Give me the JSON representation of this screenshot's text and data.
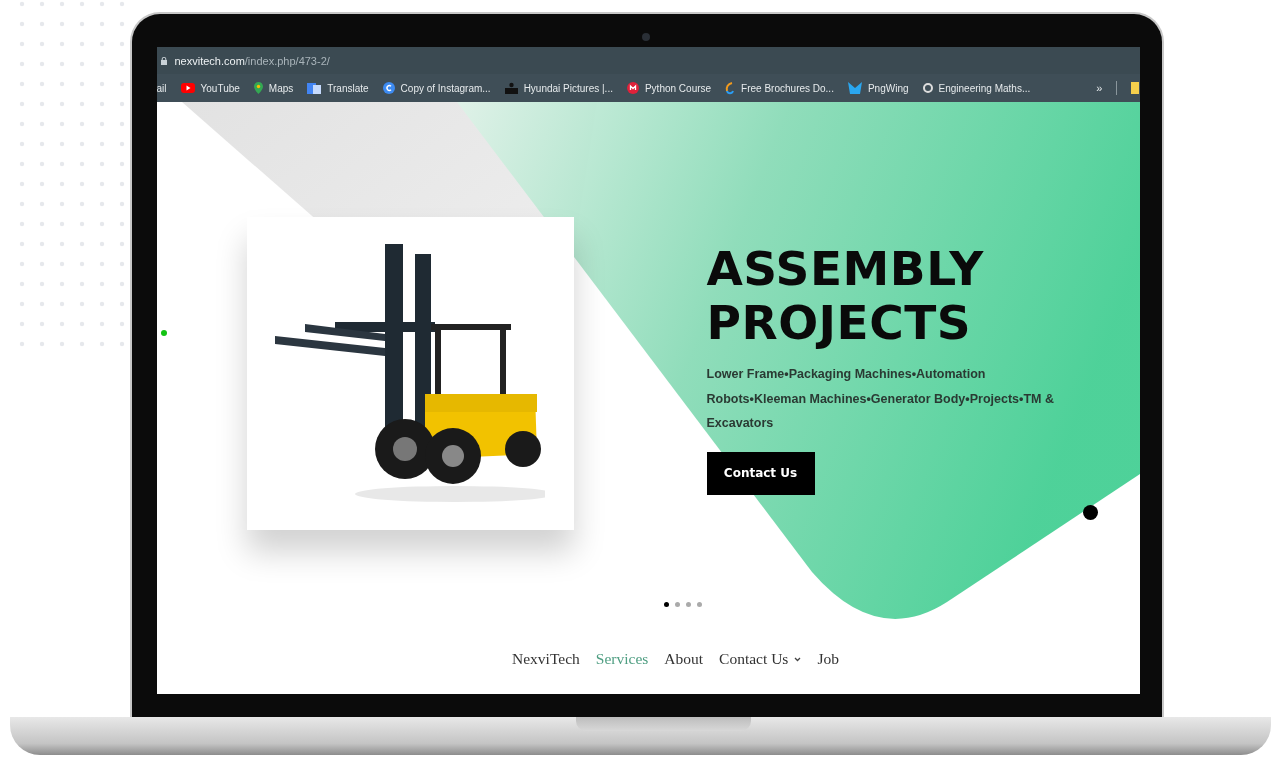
{
  "browser": {
    "url_domain": "nexvitech.com",
    "url_path": "/index.php/473-2/",
    "bookmarks": [
      {
        "label": "ail",
        "kind": "text"
      },
      {
        "label": "YouTube",
        "kind": "youtube"
      },
      {
        "label": "Maps",
        "kind": "maps"
      },
      {
        "label": "Translate",
        "kind": "translate"
      },
      {
        "label": "Copy of Instagram...",
        "kind": "letter"
      },
      {
        "label": "Hyundai Pictures |...",
        "kind": "person"
      },
      {
        "label": "Python Course",
        "kind": "badge"
      },
      {
        "label": "Free Brochures Do...",
        "kind": "swirl"
      },
      {
        "label": "PngWing",
        "kind": "wing"
      },
      {
        "label": "Engineering Maths...",
        "kind": "disc"
      }
    ],
    "overflow": "»"
  },
  "hero": {
    "title_lines": [
      "ASSEMBLY",
      "PROJECTS"
    ],
    "description": "Lower Frame•Packaging Machines•Automation Robots•Kleeman Machines•Generator Body•Projects•TM & Excavators",
    "button": "Contact Us",
    "slides": [
      {
        "selected": true
      },
      {
        "selected": false
      },
      {
        "selected": false
      },
      {
        "selected": false
      }
    ]
  },
  "nav": [
    {
      "label": "NexviTech",
      "selected": false,
      "has_menu": false
    },
    {
      "label": "Services",
      "selected": true,
      "has_menu": false
    },
    {
      "label": "About",
      "selected": false,
      "has_menu": false
    },
    {
      "label": "Contact Us",
      "selected": false,
      "has_menu": true
    },
    {
      "label": "Job",
      "selected": false,
      "has_menu": false
    }
  ]
}
